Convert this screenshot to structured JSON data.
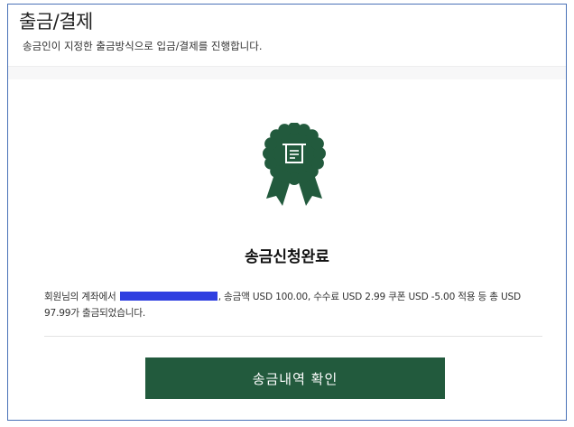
{
  "header": {
    "title": "출금/결제",
    "subtitle": "송금인이 지정한 출금방식으로 입금/결제를 진행합니다."
  },
  "completion": {
    "icon": "award-badge-atm-icon",
    "heading": "송금신청완료",
    "message_prefix": "회원님의 계좌에서",
    "message_suffix": ", 송금액 USD 100.00, 수수료 USD 2.99 쿠폰 USD -5.00 적용 등 총 USD 97.99가 출금되었습니다.",
    "redacted": true
  },
  "actions": {
    "confirm_label": "송금내역 확인"
  },
  "colors": {
    "brand_green": "#225a3d",
    "redaction_blue": "#2f3fe0",
    "frame_border": "#4a72b8"
  }
}
